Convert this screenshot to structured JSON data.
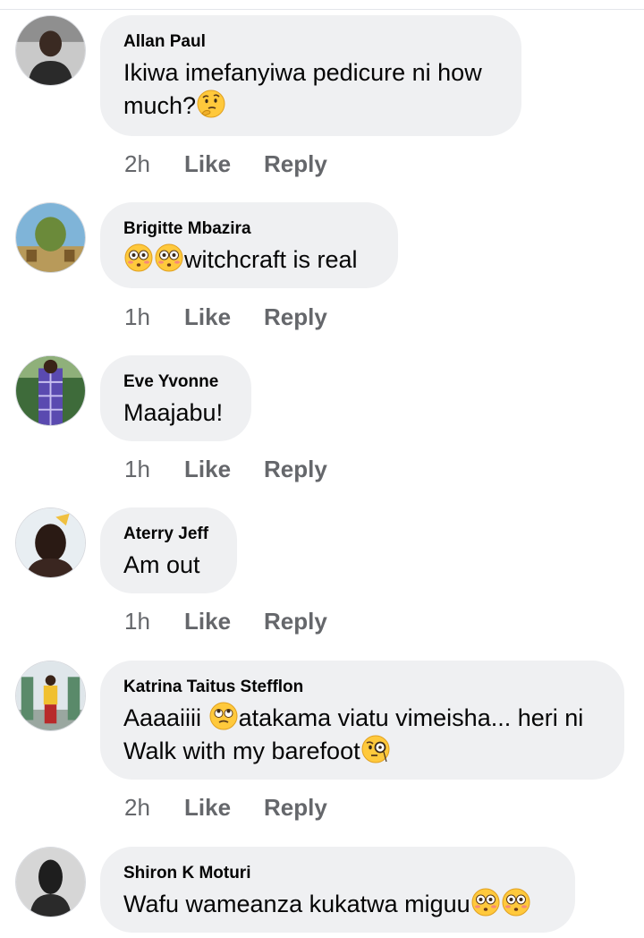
{
  "comments": [
    {
      "author": "Allan Paul",
      "lines": [
        "Ikiwa imefanyiwa pedicure ni how",
        "much?"
      ],
      "emoji": [
        "thinking-face"
      ],
      "time": "2h",
      "like_label": "Like",
      "reply_label": "Reply"
    },
    {
      "author": "Brigitte Mbazira",
      "text": "witchcraft is real",
      "emoji": [
        "flushed-face",
        "flushed-face"
      ],
      "time": "1h",
      "like_label": "Like",
      "reply_label": "Reply"
    },
    {
      "author": "Eve Yvonne",
      "text": "Maajabu!",
      "time": "1h",
      "like_label": "Like",
      "reply_label": "Reply"
    },
    {
      "author": "Aterry Jeff",
      "text": "Am out",
      "time": "1h",
      "like_label": "Like",
      "reply_label": "Reply"
    },
    {
      "author": "Katrina Taitus Stefflon",
      "line1_before": "Aaaaiiii",
      "line1_after": "atakama viatu vimeisha... heri ni",
      "line2": "Walk with my barefoot",
      "emoji": [
        "rolling-eyes-face",
        "face-with-monocle"
      ],
      "time": "2h",
      "like_label": "Like",
      "reply_label": "Reply"
    },
    {
      "author": "Shiron K Moturi",
      "text": "Wafu wameanza kukatwa miguu",
      "emoji": [
        "flushed-face",
        "flushed-face"
      ]
    }
  ],
  "colors": {
    "bubble": "#eff0f2",
    "meta_text": "#65676b",
    "emoji_yellow": "#ffc93c"
  }
}
